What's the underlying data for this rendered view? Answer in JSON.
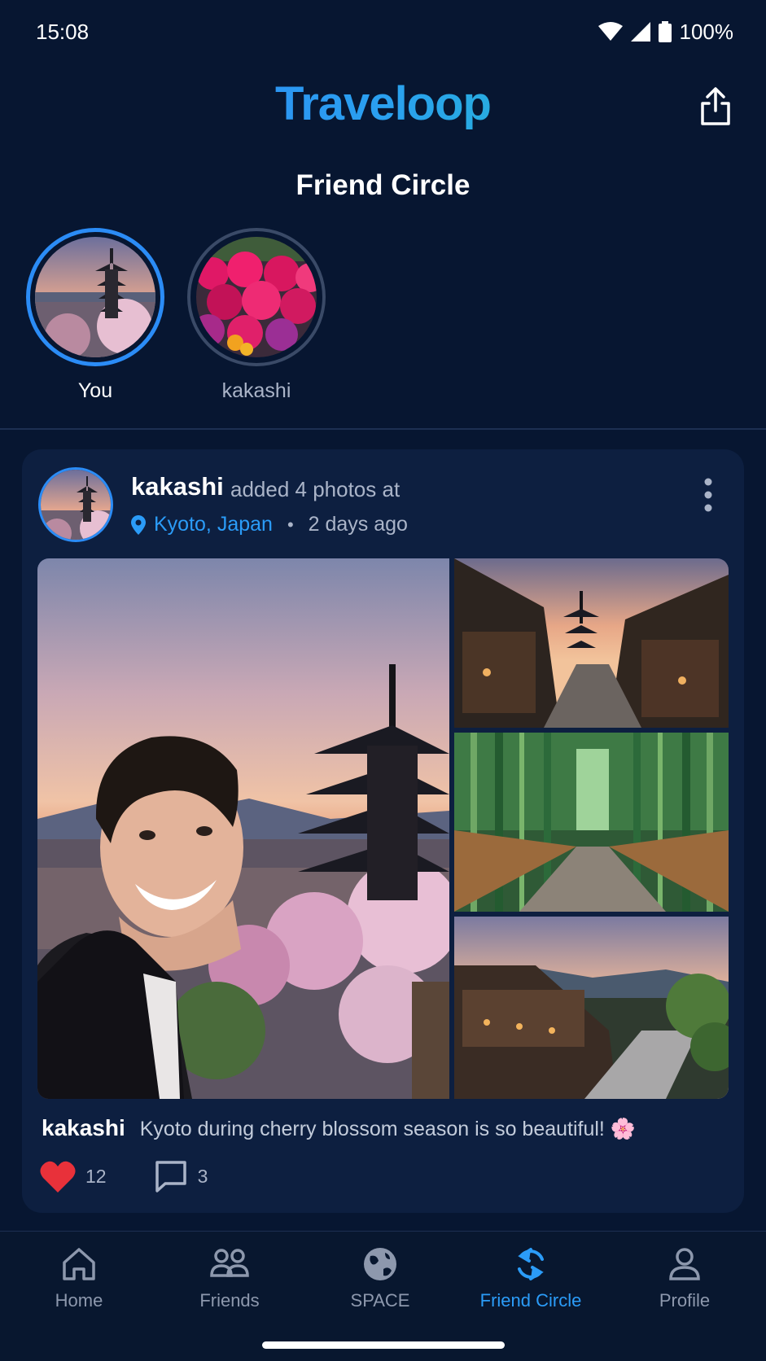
{
  "status_bar": {
    "time": "15:08",
    "battery": "100%",
    "icons": [
      "wifi-icon",
      "signal-icon",
      "battery-icon"
    ]
  },
  "header": {
    "logo": "Traveloop",
    "share_icon": "share-icon"
  },
  "page_title": "Friend Circle",
  "stories": [
    {
      "label": "You",
      "active": true
    },
    {
      "label": "kakashi",
      "active": false
    }
  ],
  "post": {
    "author": "kakashi",
    "action": "added 4 photos at",
    "location": "Kyoto, Japan",
    "separator": "•",
    "time_ago": "2 days ago",
    "caption_author": "kakashi",
    "caption": "Kyoto during cherry blossom season is so beautiful! 🌸",
    "likes": "12",
    "comments": "3"
  },
  "bottom_nav": [
    {
      "label": "Home",
      "icon": "home-icon",
      "active": false
    },
    {
      "label": "Friends",
      "icon": "friends-icon",
      "active": false
    },
    {
      "label": "SPACE",
      "icon": "globe-icon",
      "active": false
    },
    {
      "label": "Friend Circle",
      "icon": "sync-icon",
      "active": true
    },
    {
      "label": "Profile",
      "icon": "profile-icon",
      "active": false
    }
  ],
  "colors": {
    "background": "#071631",
    "card": "#0d1f40",
    "accent": "#2b9cf8",
    "like": "#e8313a"
  }
}
